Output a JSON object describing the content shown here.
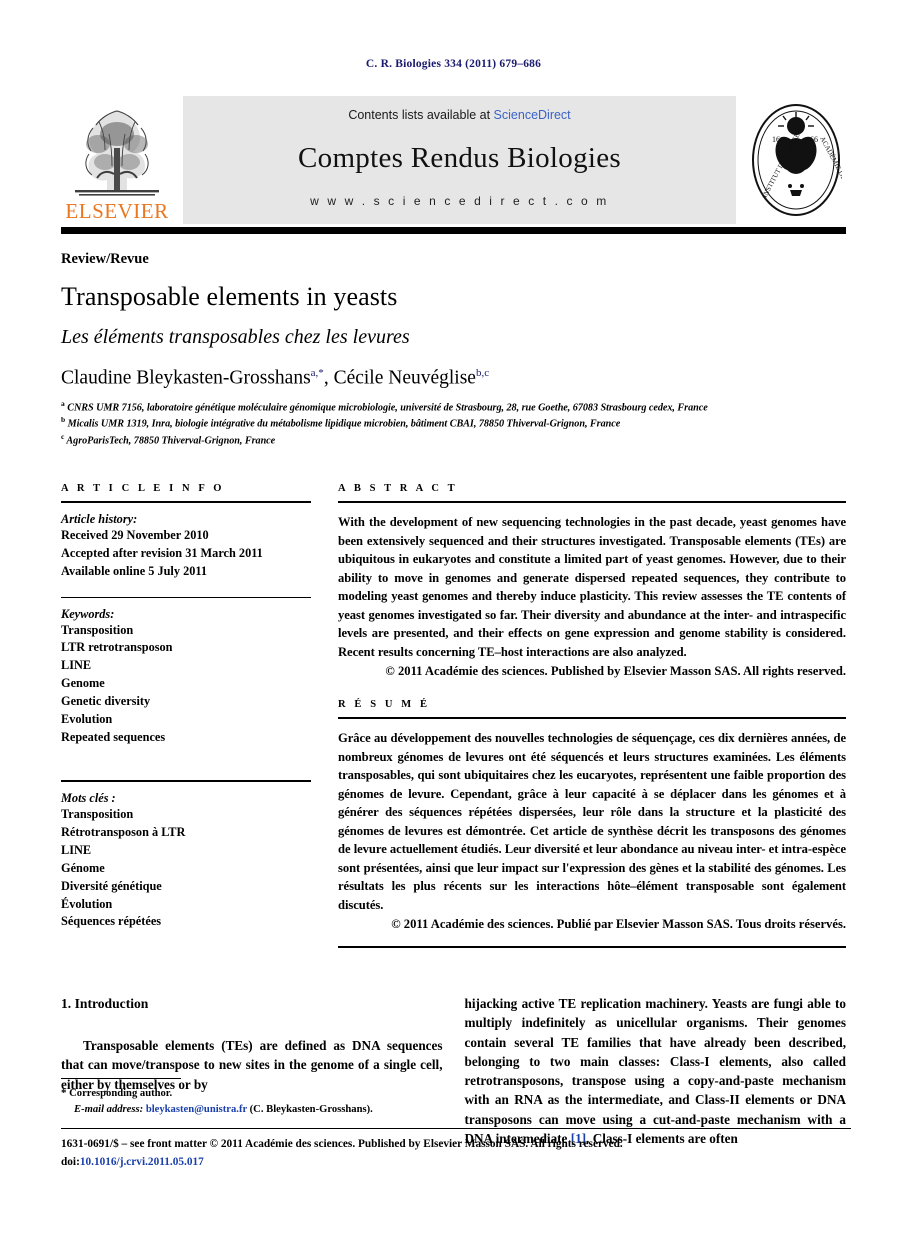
{
  "running_head": "C. R. Biologies 334 (2011) 679–686",
  "masthead": {
    "publisher_name": "ELSEVIER",
    "contents_prefix": "Contents lists available at ",
    "contents_link": "ScienceDirect",
    "journal_title": "Comptes Rendus Biologies",
    "website": "w w w . s c i e n c e d i r e c t . c o m",
    "academy_text": "INSTITUT DE FRANCE · ACADÉMIE DES SCIENCES"
  },
  "article": {
    "kind": "Review/Revue",
    "title_en": "Transposable elements in yeasts",
    "title_fr": "Les éléments transposables chez les levures",
    "authors": [
      {
        "name": "Claudine Bleykasten-Grosshans",
        "marks": "a,*"
      },
      {
        "name": "Cécile Neuvéglise",
        "marks": "b,c"
      }
    ],
    "authors_separator": ", ",
    "affiliations": [
      {
        "mark": "a",
        "text": "CNRS UMR 7156, laboratoire génétique moléculaire génomique microbiologie, université de Strasbourg, 28, rue Goethe, 67083 Strasbourg cedex, France"
      },
      {
        "mark": "b",
        "text": "Micalis UMR 1319, Inra, biologie intégrative du métabolisme lipidique microbien, bâtiment CBAI, 78850 Thiverval-Grignon, France"
      },
      {
        "mark": "c",
        "text": "AgroParisTech, 78850 Thiverval-Grignon, France"
      }
    ]
  },
  "info": {
    "heading": "A R T I C L E   I N F O",
    "history_label": "Article history:",
    "history": [
      "Received 29 November 2010",
      "Accepted after revision 31 March 2011",
      "Available online 5 July 2011"
    ],
    "keywords_label": "Keywords:",
    "keywords": [
      "Transposition",
      "LTR retrotransposon",
      "LINE",
      "Genome",
      "Genetic diversity",
      "Evolution",
      "Repeated sequences"
    ],
    "motscles_label": "Mots clés :",
    "motscles": [
      "Transposition",
      "Rétrotransposon à LTR",
      "LINE",
      "Génome",
      "Diversité génétique",
      "Évolution",
      "Séquences répétées"
    ]
  },
  "abstract": {
    "heading": "A B S T R A C T",
    "text": "With the development of new sequencing technologies in the past decade, yeast genomes have been extensively sequenced and their structures investigated. Transposable elements (TEs) are ubiquitous in eukaryotes and constitute a limited part of yeast genomes. However, due to their ability to move in genomes and generate dispersed repeated sequences, they contribute to modeling yeast genomes and thereby induce plasticity. This review assesses the TE contents of yeast genomes investigated so far. Their diversity and abundance at the inter- and intraspecific levels are presented, and their effects on gene expression and genome stability is considered. Recent results concerning TE–host interactions are also analyzed.",
    "copyright": "© 2011 Académie des sciences. Published by Elsevier Masson SAS. All rights reserved."
  },
  "resume": {
    "heading": "R É S U M É",
    "text": "Grâce au développement des nouvelles technologies de séquençage, ces dix dernières années, de nombreux génomes de levures ont été séquencés et leurs structures examinées. Les éléments transposables, qui sont ubiquitaires chez les eucaryotes, représentent une faible proportion des génomes de levure. Cependant, grâce à leur capacité à se déplacer dans les génomes et à générer des séquences répétées dispersées, leur rôle dans la structure et la plasticité des génomes de levures est démontrée. Cet article de synthèse décrit les transposons des génomes de levure actuellement étudiés. Leur diversité et leur abondance au niveau inter- et intra-espèce sont présentées, ainsi que leur impact sur l'expression des gènes et la stabilité des génomes. Les résultats les plus récents sur les interactions hôte–élément transposable sont également discutés.",
    "copyright": "© 2011 Académie des sciences. Publié par Elsevier Masson SAS. Tous droits réservés."
  },
  "body": {
    "section_number_title": "1. Introduction",
    "left_paragraph": "Transposable elements (TEs) are defined as DNA sequences that can move/transpose to new sites in the genome of a single cell, either by themselves or by",
    "right_text_before_cite": "hijacking active TE replication machinery. Yeasts are fungi able to multiply indefinitely as unicellular organisms. Their genomes contain several TE families that have already been described, belonging to two main classes: Class-I elements, also called retrotransposons, transpose using a copy-and-paste mechanism with an RNA as the intermediate, and Class-II elements or DNA transposons can move using a cut-and-paste mechanism with a DNA intermediate ",
    "citation": "[1]",
    "right_text_after_cite": ". Class-I elements are often"
  },
  "footnotes": {
    "corresponding_marker": "*",
    "corresponding_label": "Corresponding author.",
    "email_label": "E-mail address:",
    "email": "bleykasten@unistra.fr",
    "email_owner": "(C. Bleykasten-Grosshans)."
  },
  "footer": {
    "issn_line": "1631-0691/$ – see front matter © 2011 Académie des sciences. Published by Elsevier Masson SAS. All rights reserved.",
    "doi_label": "doi:",
    "doi": "10.1016/j.crvi.2011.05.017"
  },
  "colors": {
    "running_head": "#1a1a6e",
    "link": "#3a63c8",
    "citation": "#1a3faa",
    "elsevier_orange": "#E87722",
    "band_gray": "#e6e6e6"
  }
}
